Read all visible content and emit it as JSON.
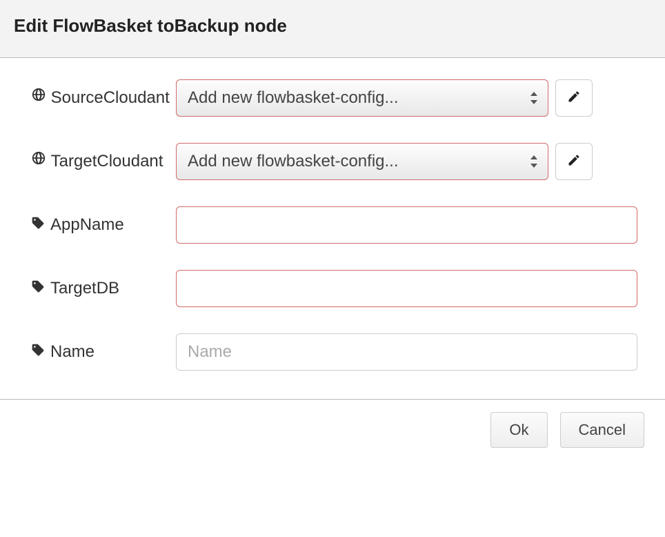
{
  "header": {
    "title": "Edit FlowBasket toBackup node"
  },
  "form": {
    "sourceCloudant": {
      "label": "SourceCloudant",
      "selected": "Add new flowbasket-config..."
    },
    "targetCloudant": {
      "label": "TargetCloudant",
      "selected": "Add new flowbasket-config..."
    },
    "appName": {
      "label": "AppName",
      "value": ""
    },
    "targetDB": {
      "label": "TargetDB",
      "value": ""
    },
    "name": {
      "label": "Name",
      "value": "",
      "placeholder": "Name"
    }
  },
  "footer": {
    "ok": "Ok",
    "cancel": "Cancel"
  }
}
